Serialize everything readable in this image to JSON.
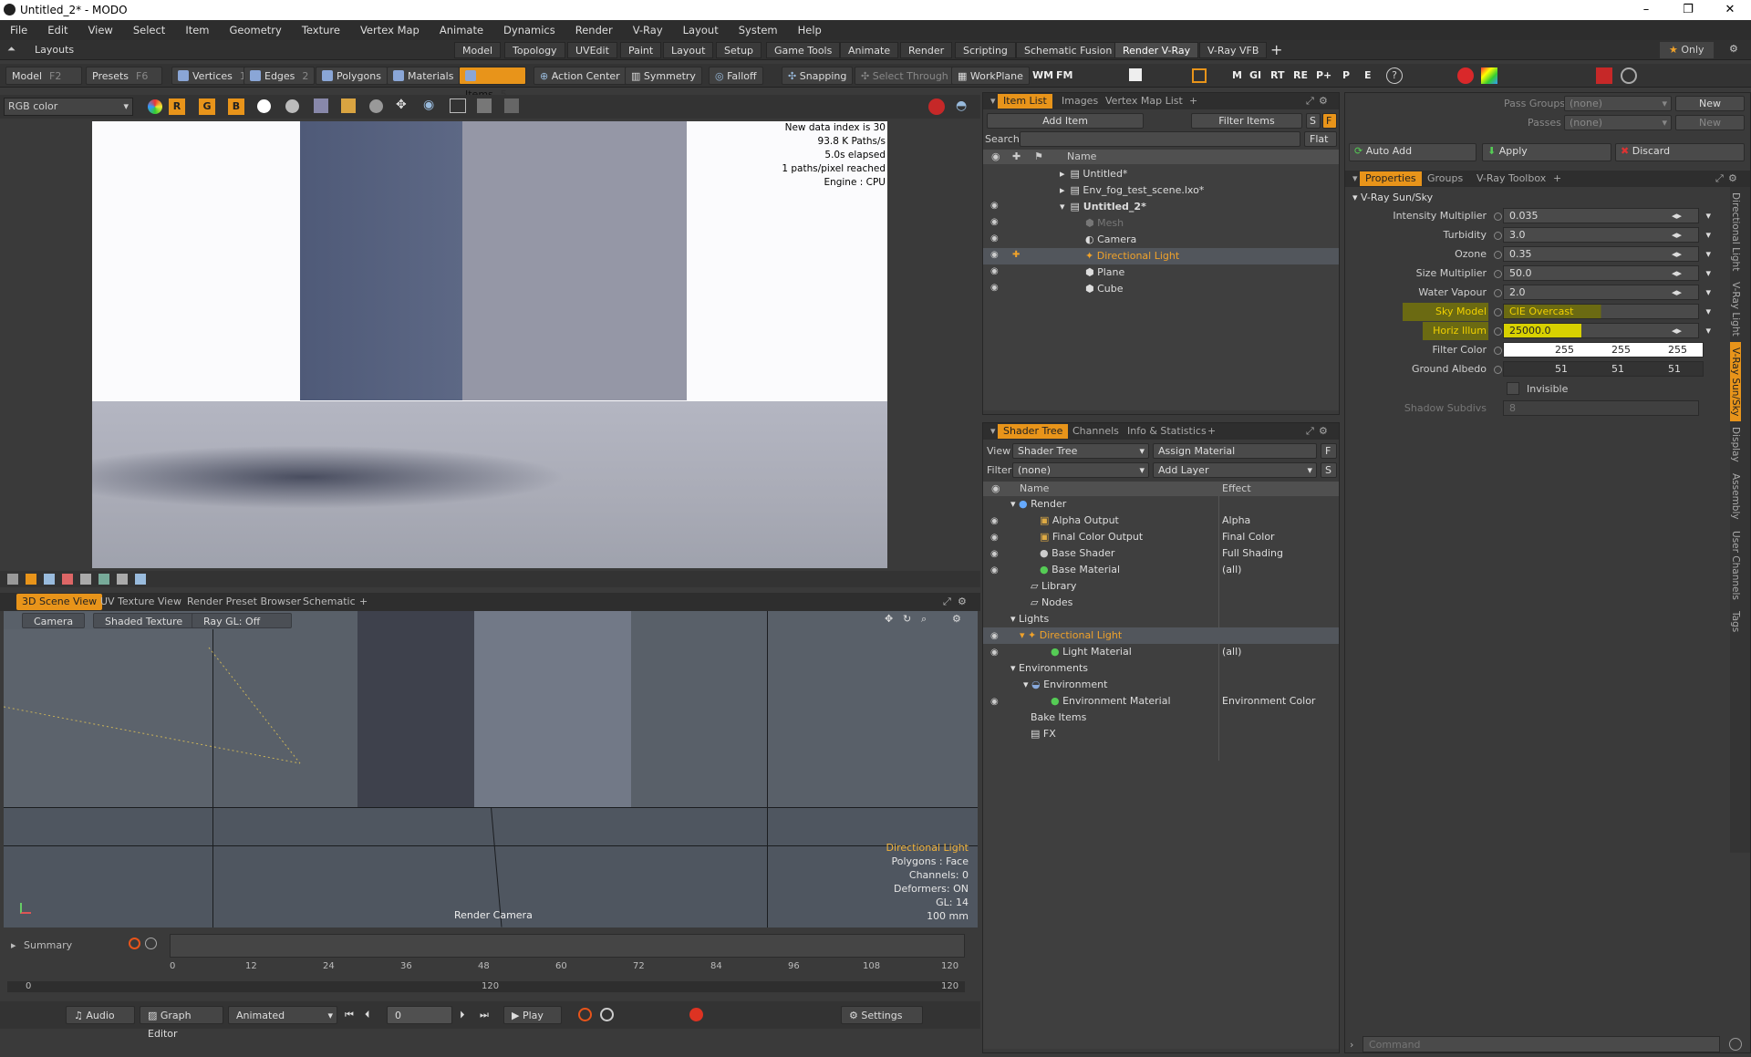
{
  "window": {
    "title": "Untitled_2* - MODO",
    "min": "–",
    "max": "❐",
    "close": "✕"
  },
  "menu": [
    "File",
    "Edit",
    "View",
    "Select",
    "Item",
    "Geometry",
    "Texture",
    "Vertex Map",
    "Animate",
    "Dynamics",
    "Render",
    "V-Ray",
    "Layout",
    "System",
    "Help"
  ],
  "layoutbar": {
    "label": "Layouts",
    "tabs": [
      "Model",
      "Topology",
      "UVEdit",
      "Paint",
      "Layout",
      "Setup",
      "Game Tools",
      "Animate",
      "Render",
      "Scripting",
      "Schematic Fusion",
      "Render V-Ray",
      "V-Ray VFB"
    ],
    "active": "Render V-Ray",
    "only": "Only"
  },
  "toolbar": {
    "model": "Model",
    "model_key": "F2",
    "presets": "Presets",
    "presets_key": "F6",
    "vertices": "Vertices",
    "vertices_key": "1",
    "edges": "Edges",
    "edges_key": "2",
    "polygons": "Polygons",
    "materials": "Materials",
    "items": "Items",
    "items_key": "5",
    "action_center": "Action Center",
    "symmetry": "Symmetry",
    "falloff": "Falloff",
    "snapping": "Snapping",
    "select_through": "Select Through",
    "workplane": "WorkPlane",
    "vray_buttons": [
      "WM",
      "FM",
      "M",
      "GI",
      "RT",
      "RE",
      "P+",
      "P",
      "E"
    ]
  },
  "render_view": {
    "channel": "RGB color",
    "stats": [
      "New data index is 30",
      "93.8 K Paths/s",
      "5.0s elapsed",
      "1 paths/pixel reached",
      "Engine : CPU"
    ]
  },
  "viewport_tabs": [
    "3D Scene View",
    "UV Texture View",
    "Render Preset Browser",
    "Schematic"
  ],
  "scene": {
    "camera_btn": "Camera",
    "shade_btn": "Shaded Texture",
    "raygl_btn": "Ray GL: Off",
    "label": "Render Camera",
    "info": {
      "item": "Directional Light",
      "polygons": "Polygons : Face",
      "channels": "Channels: 0",
      "deformers": "Deformers: ON",
      "gl": "GL: 14",
      "size": "100 mm"
    }
  },
  "timeline": {
    "summary": "Summary",
    "ticks": [
      "0",
      "12",
      "24",
      "36",
      "48",
      "60",
      "72",
      "84",
      "96",
      "108",
      "120"
    ],
    "range_start": "0",
    "range_mid": "120",
    "range_end": "120"
  },
  "transport": {
    "audio": "Audio",
    "graph_editor": "Graph Editor",
    "animated": "Animated",
    "frame": "0",
    "play": "Play",
    "settings": "Settings"
  },
  "item_list": {
    "tabs": [
      "Item List",
      "Images",
      "Vertex Map List"
    ],
    "add_item": "Add Item",
    "filter_items": "Filter Items",
    "search_label": "Search",
    "flat": "Flat",
    "name_col": "Name",
    "items": [
      "Untitled*",
      "Env_fog_test_scene.lxo*",
      "Untitled_2*",
      "Mesh",
      "Camera",
      "Directional Light",
      "Plane",
      "Cube"
    ]
  },
  "shader_tree": {
    "tabs": [
      "Shader Tree",
      "Channels",
      "Info & Statistics"
    ],
    "view_label": "View",
    "view_value": "Shader Tree",
    "assign_material": "Assign Material",
    "filter_label": "Filter",
    "filter_value": "(none)",
    "add_layer": "Add Layer",
    "name_col": "Name",
    "effect_col": "Effect",
    "rows": [
      {
        "name": "Render",
        "effect": ""
      },
      {
        "name": "Alpha Output",
        "effect": "Alpha"
      },
      {
        "name": "Final Color Output",
        "effect": "Final Color"
      },
      {
        "name": "Base Shader",
        "effect": "Full Shading"
      },
      {
        "name": "Base Material",
        "effect": "(all)"
      },
      {
        "name": "Library",
        "effect": ""
      },
      {
        "name": "Nodes",
        "effect": ""
      },
      {
        "name": "Lights",
        "effect": ""
      },
      {
        "name": "Directional Light",
        "effect": ""
      },
      {
        "name": "Light Material",
        "effect": "(all)"
      },
      {
        "name": "Environments",
        "effect": ""
      },
      {
        "name": "Environment",
        "effect": ""
      },
      {
        "name": "Environment Material",
        "effect": "Environment Color"
      },
      {
        "name": "Bake Items",
        "effect": ""
      },
      {
        "name": "FX",
        "effect": ""
      }
    ]
  },
  "passes": {
    "pass_groups": "Pass Groups",
    "passes": "Passes",
    "none": "(none)",
    "new": "New",
    "auto_add": "Auto Add",
    "apply": "Apply",
    "discard": "Discard"
  },
  "properties": {
    "tabs": [
      "Properties",
      "Groups",
      "V-Ray Toolbox"
    ],
    "section": "V-Ray Sun/Sky",
    "rows": [
      {
        "label": "Intensity Multiplier",
        "value": "0.035"
      },
      {
        "label": "Turbidity",
        "value": "3.0"
      },
      {
        "label": "Ozone",
        "value": "0.35"
      },
      {
        "label": "Size Multiplier",
        "value": "50.0"
      },
      {
        "label": "Water Vapour",
        "value": "2.0"
      },
      {
        "label": "Sky Model",
        "value": "CIE Overcast"
      },
      {
        "label": "Horiz Illum",
        "value": "25000.0"
      }
    ],
    "filter_color_label": "Filter Color",
    "filter_color": [
      "255",
      "255",
      "255"
    ],
    "ground_albedo_label": "Ground Albedo",
    "ground_albedo": [
      "51",
      "51",
      "51"
    ],
    "invisible": "Invisible",
    "shadow_subdivs_label": "Shadow Subdivs",
    "shadow_subdivs": "8"
  },
  "side_tabs": [
    "Directional Light",
    "V-Ray Light",
    "V-Ray Sun/Sky",
    "Display",
    "Assembly",
    "User Channels",
    "Tags"
  ],
  "command": {
    "placeholder": "Command"
  },
  "colors": {
    "accent": "#e8941a",
    "highlight": "#d8d100"
  }
}
